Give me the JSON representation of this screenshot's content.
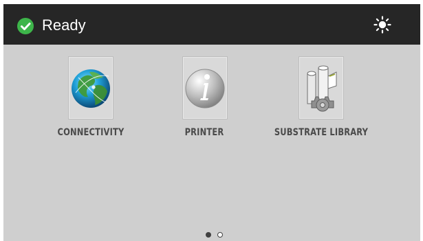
{
  "header": {
    "status_text": "Ready",
    "status_icon": "check-circle-icon",
    "status_color": "#3db54a",
    "settings_icon": "brightness-icon"
  },
  "apps": [
    {
      "id": "connectivity",
      "label": "CONNECTIVITY",
      "icon": "globe-icon"
    },
    {
      "id": "printer",
      "label": "PRINTER",
      "icon": "info-icon"
    },
    {
      "id": "substrate",
      "label": "SUBSTRATE LIBRARY",
      "icon": "substrate-rolls-gear-icon"
    }
  ],
  "pager": {
    "current_page": 1,
    "total_pages": 2
  }
}
